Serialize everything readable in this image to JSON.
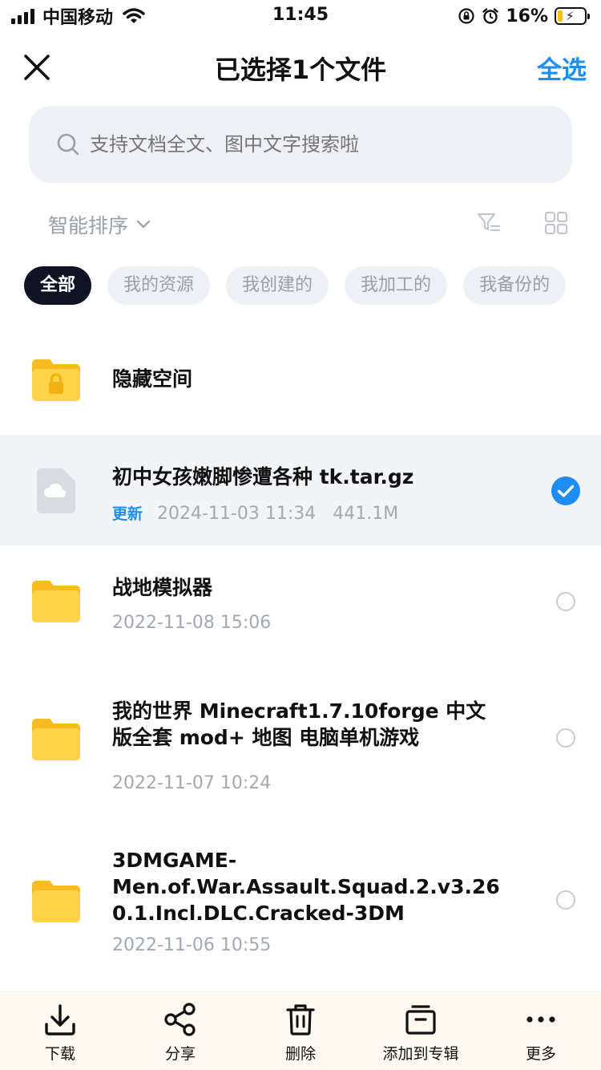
{
  "status_bar": {
    "carrier": "中国移动",
    "time": "11:45",
    "battery_percent": "16%",
    "icons": [
      "signal-icon",
      "wifi-icon",
      "rotation-lock-icon",
      "alarm-icon",
      "battery-charging-icon"
    ]
  },
  "header": {
    "title": "已选择1个文件",
    "select_all": "全选",
    "close_icon": "close-icon"
  },
  "search": {
    "placeholder": "支持文档全文、图中文字搜索啦"
  },
  "sort": {
    "label": "智能排序"
  },
  "chips": [
    "全部",
    "我的资源",
    "我创建的",
    "我加工的",
    "我备份的"
  ],
  "files": [
    {
      "name": "隐藏空间",
      "type": "locked-folder"
    },
    {
      "name": "初中女孩嫩脚惨遭各种 tk.tar.gz",
      "tag": "更新",
      "date": "2024-11-03 11:34",
      "size": "441.1M",
      "type": "cloud-file",
      "selected": true
    },
    {
      "name": "战地模拟器",
      "date": "2022-11-08 15:06",
      "type": "folder",
      "selected": false
    },
    {
      "name_line1": "我的世界 Minecraft1.7.10forge 中文",
      "name_line2": "版全套 mod+ 地图 电脑单机游戏",
      "date": "2022-11-07 10:24",
      "type": "folder",
      "selected": false
    },
    {
      "name_line1": "3DMGAME-",
      "name_line2": "Men.of.War.Assault.Squad.2.v3.26",
      "name_line3": "0.1.Incl.DLC.Cracked-3DM",
      "date": "2022-11-06 10:55",
      "type": "folder",
      "selected": false
    }
  ],
  "bottom_bar": {
    "download": "下载",
    "share": "分享",
    "delete": "删除",
    "add_to_album": "添加到专辑",
    "more": "更多"
  },
  "colors": {
    "accent": "#1e8ef5",
    "chip_active_bg": "#0f1424",
    "folder": "#ffcd3a",
    "selected_row_bg": "#f2f4f8"
  }
}
